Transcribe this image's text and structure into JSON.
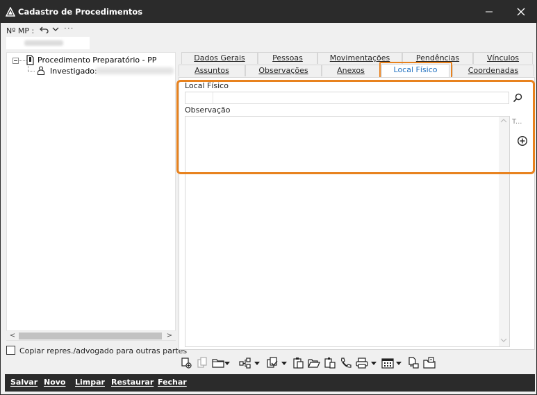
{
  "window": {
    "title": "Cadastro de Procedimentos",
    "minimize_glyph": "—",
    "close_glyph": "✕"
  },
  "mp": {
    "label": "Nº MP :",
    "more": "···",
    "value": ""
  },
  "tree": {
    "root_label": "Procedimento Preparatório - PP",
    "child_label": "Investigado:",
    "scroll_left": "<",
    "scroll_right": ">"
  },
  "copy_option": {
    "label": "Copiar repres./advogado para outras partes",
    "checked": false
  },
  "tabs": {
    "row1": [
      "Dados Gerais",
      "Pessoas",
      "Movimentações",
      "Pendências",
      "Vínculos"
    ],
    "row2": [
      "Assuntos",
      "Observações",
      "Anexos",
      "Local Físico",
      "Coordenadas"
    ],
    "active": "Local Físico"
  },
  "form": {
    "local_fisico_label": "Local Físico",
    "local_fisico_value": "",
    "observacao_label": "Observação",
    "observacao_value": "",
    "side_label": "T..."
  },
  "toolbar": {
    "icons": [
      "add-document-icon",
      "copy-document-icon",
      "folder-icon",
      "tree-structure-icon",
      "batch-document-icon",
      "clipboard-icon",
      "open-folder-icon",
      "notes-icon",
      "phone-icon",
      "print-icon",
      "calendar-icon",
      "edit-document-icon",
      "archive-icon"
    ]
  },
  "actions": {
    "save": "Salvar",
    "new": "Novo",
    "clear": "Limpar",
    "restore": "Restaurar",
    "close": "Fechar"
  },
  "colors": {
    "titlebar": "#2b2b2b",
    "highlight": "#e8821e",
    "active_tab_text": "#1e6fbf"
  }
}
